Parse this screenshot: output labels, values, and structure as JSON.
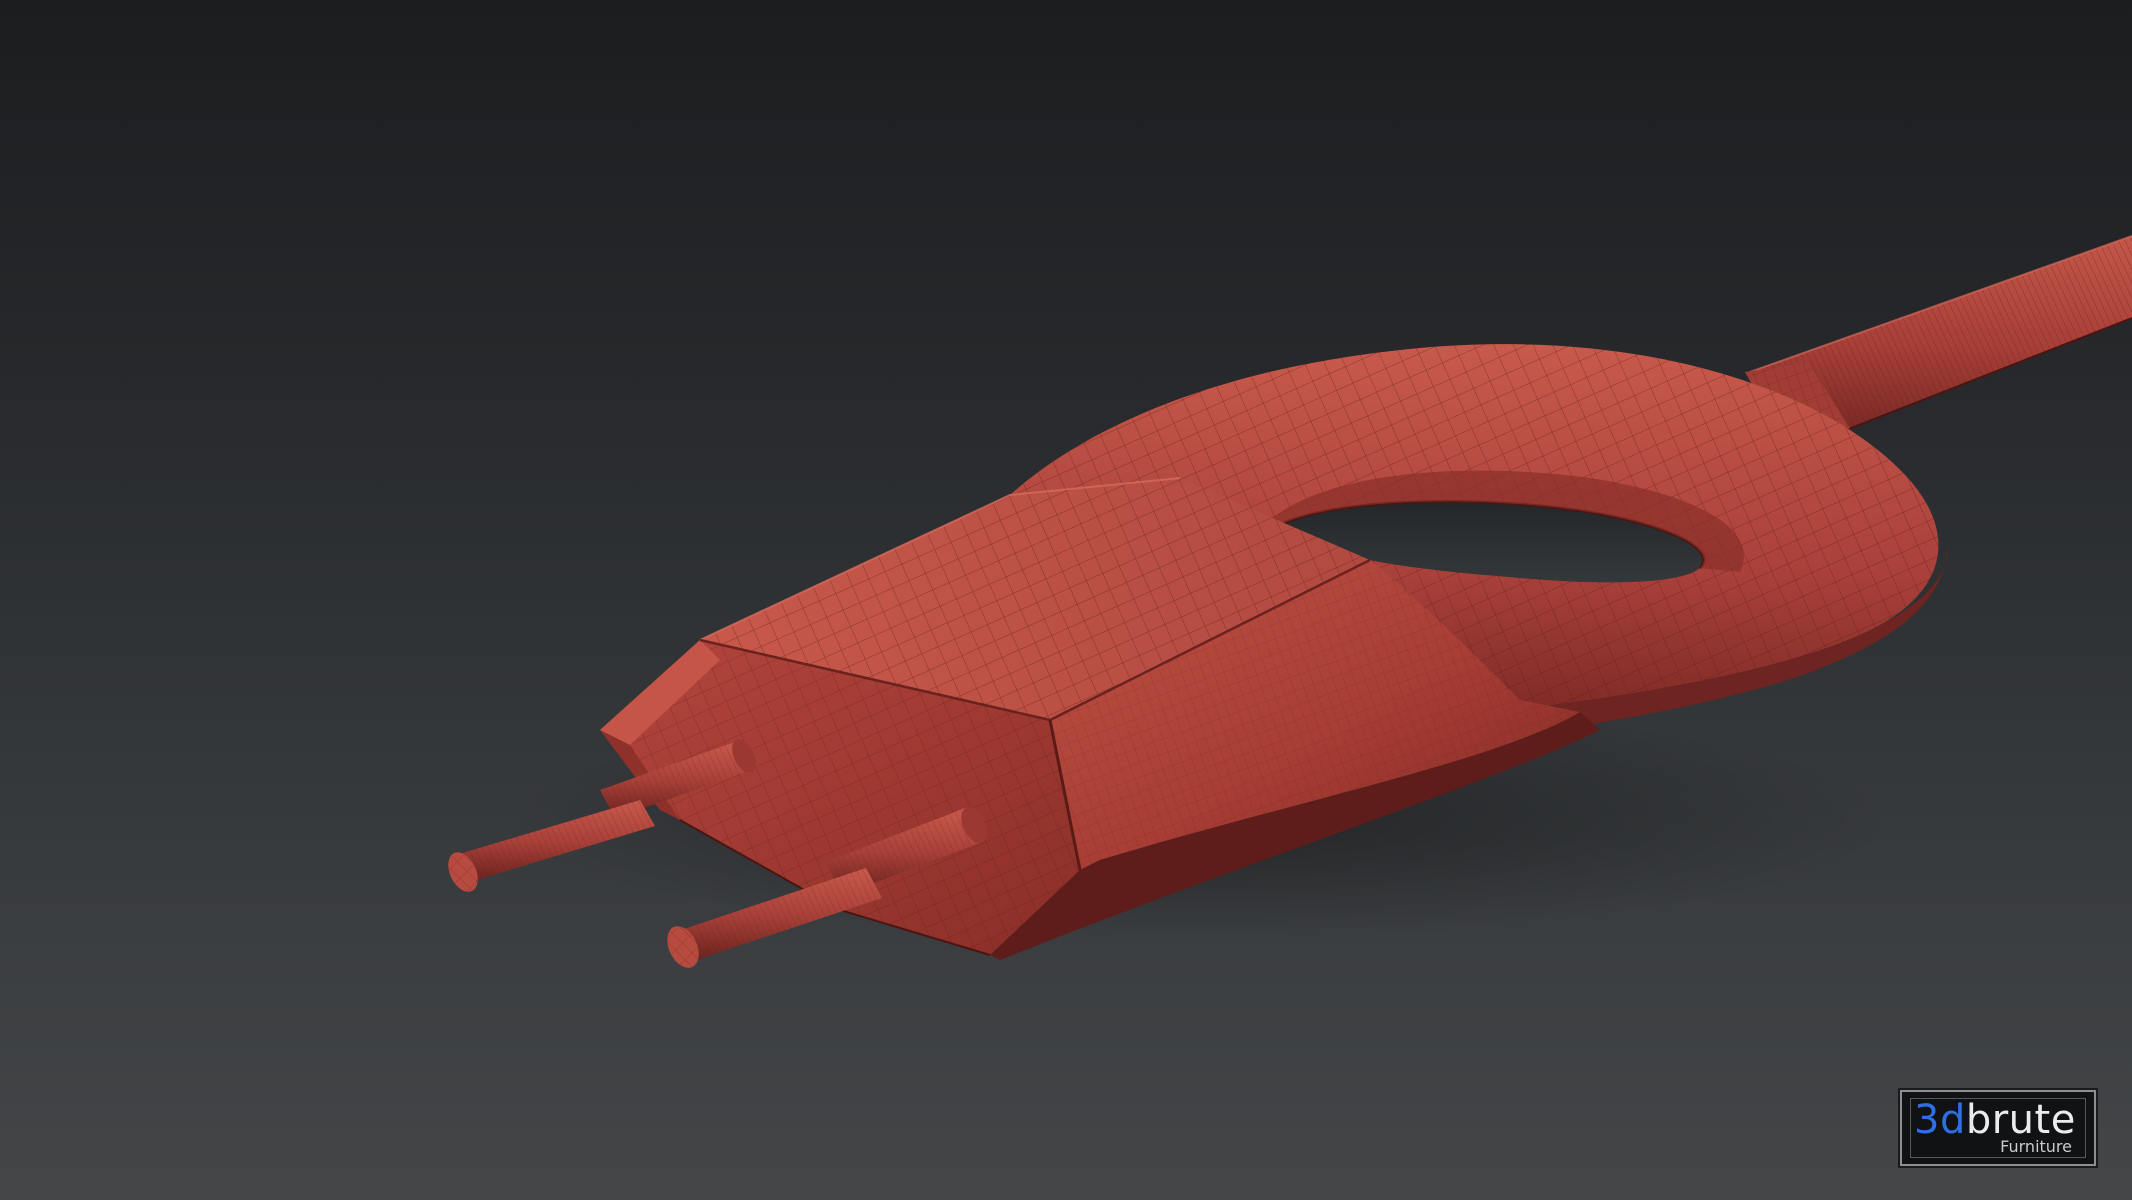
{
  "scene": {
    "subject": "electric-plug-wireframe-render",
    "colors": {
      "background_top": "#1b1d1f",
      "background_bottom": "#444648",
      "model_red": "#b3483e",
      "model_dark": "#6e2420",
      "wire_lines": "#5a1a16"
    }
  },
  "watermark": {
    "logo_prefix": "3d",
    "logo_suffix": "brute",
    "subtitle": "Furniture",
    "accent_color": "#2f6fe6"
  }
}
